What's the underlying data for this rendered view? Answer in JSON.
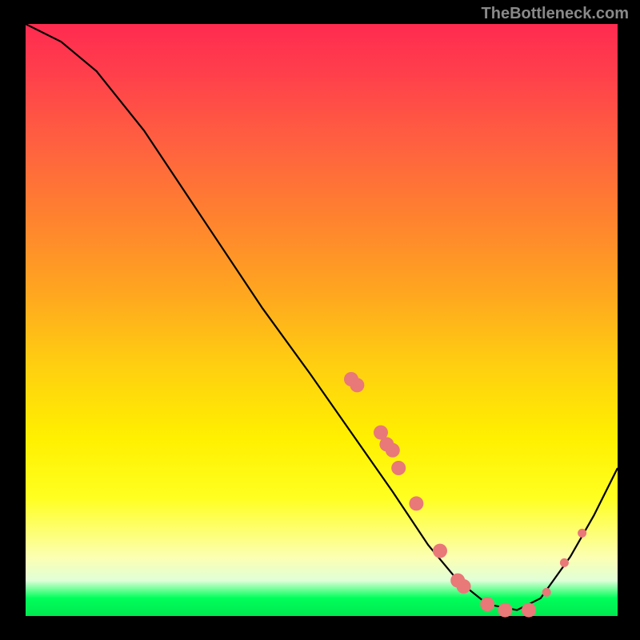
{
  "watermark": "TheBottleneck.com",
  "chart_data": {
    "type": "line",
    "title": "",
    "xlabel": "",
    "ylabel": "",
    "xlim": [
      0,
      100
    ],
    "ylim": [
      0,
      100
    ],
    "grid": false,
    "curve": [
      {
        "x": 0,
        "y": 100
      },
      {
        "x": 6,
        "y": 97
      },
      {
        "x": 12,
        "y": 92
      },
      {
        "x": 20,
        "y": 82
      },
      {
        "x": 30,
        "y": 67
      },
      {
        "x": 40,
        "y": 52
      },
      {
        "x": 48,
        "y": 41
      },
      {
        "x": 55,
        "y": 31
      },
      {
        "x": 62,
        "y": 21
      },
      {
        "x": 68,
        "y": 12
      },
      {
        "x": 73,
        "y": 6
      },
      {
        "x": 78,
        "y": 2
      },
      {
        "x": 83,
        "y": 1
      },
      {
        "x": 87,
        "y": 3
      },
      {
        "x": 92,
        "y": 10
      },
      {
        "x": 96,
        "y": 17
      },
      {
        "x": 100,
        "y": 25
      }
    ],
    "points_big": [
      {
        "x": 55,
        "y": 40
      },
      {
        "x": 56,
        "y": 39
      },
      {
        "x": 60,
        "y": 31
      },
      {
        "x": 61,
        "y": 29
      },
      {
        "x": 62,
        "y": 28
      },
      {
        "x": 63,
        "y": 25
      },
      {
        "x": 66,
        "y": 19
      },
      {
        "x": 70,
        "y": 11
      },
      {
        "x": 73,
        "y": 6
      },
      {
        "x": 74,
        "y": 5
      },
      {
        "x": 78,
        "y": 2
      },
      {
        "x": 81,
        "y": 1
      },
      {
        "x": 85,
        "y": 1
      }
    ],
    "points_small": [
      {
        "x": 88,
        "y": 4
      },
      {
        "x": 91,
        "y": 9
      },
      {
        "x": 94,
        "y": 14
      }
    ],
    "point_color": "#e97878",
    "curve_color": "#000000"
  }
}
